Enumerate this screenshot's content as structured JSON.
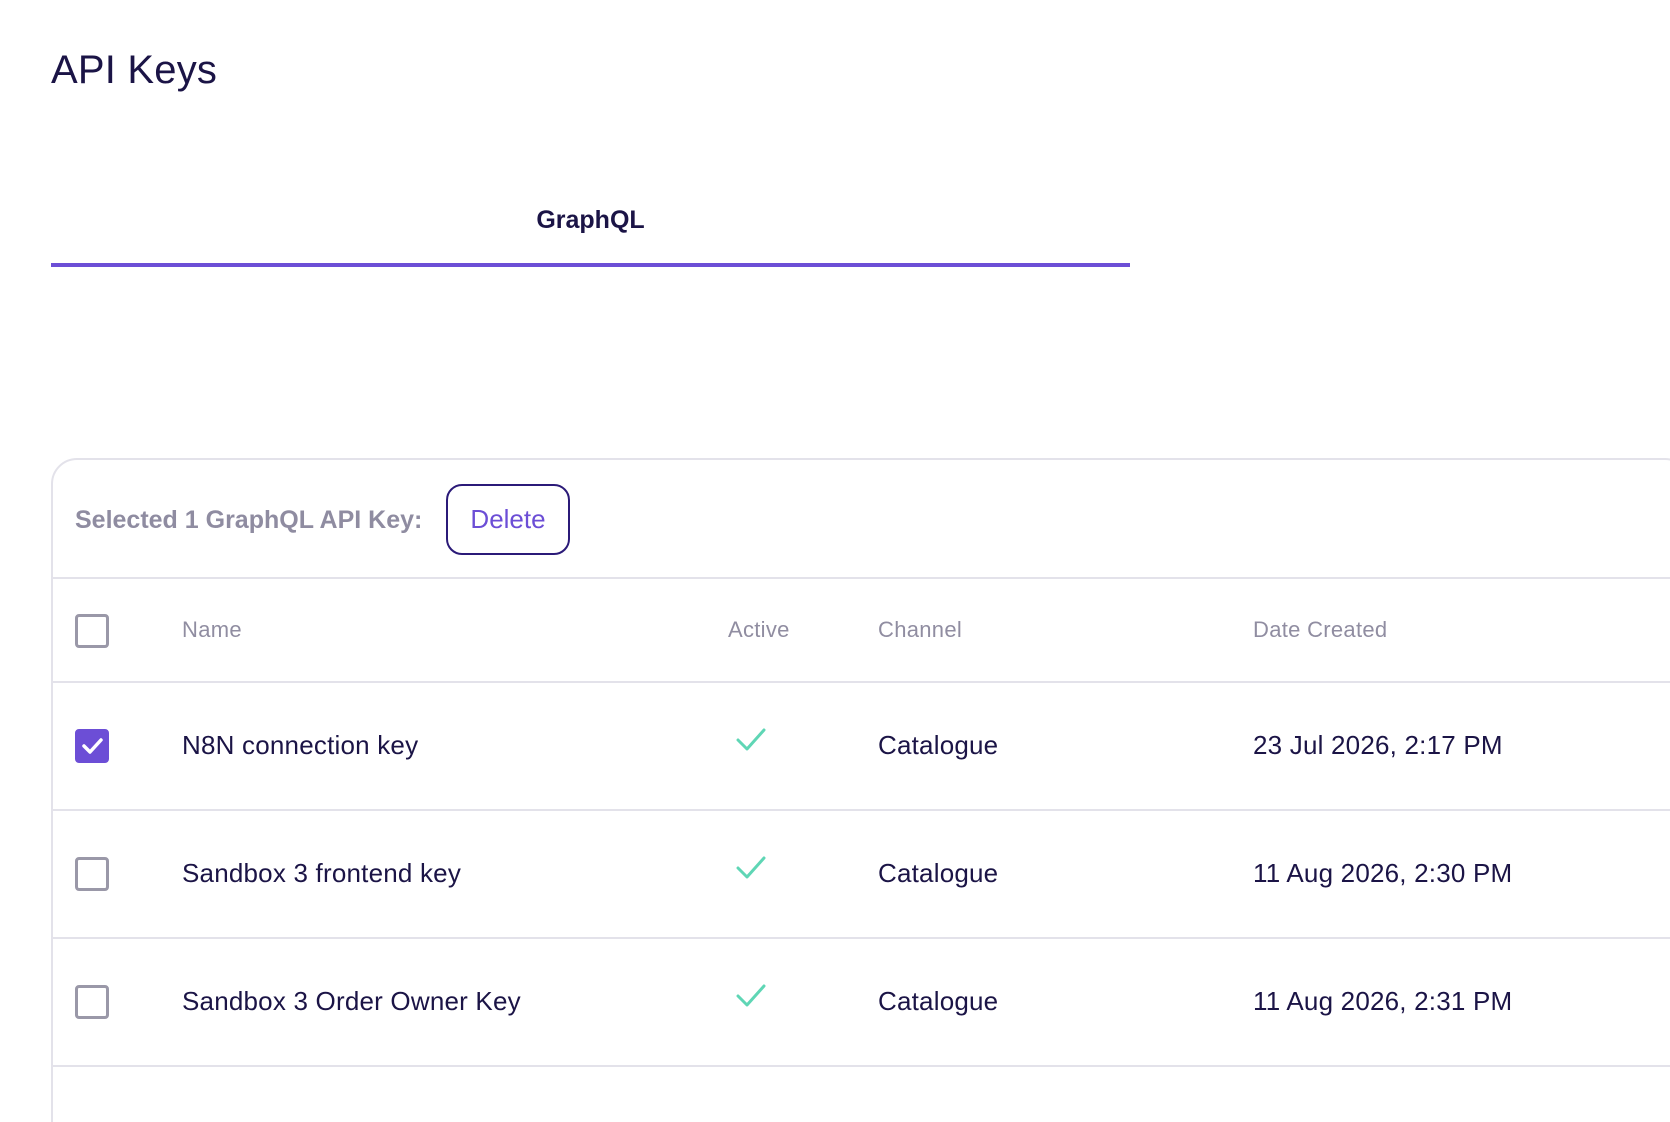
{
  "page": {
    "title": "API Keys"
  },
  "tabs": [
    {
      "label": "GraphQL",
      "active": true
    }
  ],
  "toolbar": {
    "selected_text": "Selected 1 GraphQL API Key:",
    "delete_label": "Delete"
  },
  "table": {
    "headers": [
      "Name",
      "Active",
      "Channel",
      "Date Created"
    ],
    "rows": [
      {
        "selected": true,
        "name": "N8N connection key",
        "active": true,
        "channel": "Catalogue",
        "date_created": "23 Jul 2026, 2:17 PM"
      },
      {
        "selected": false,
        "name": "Sandbox 3 frontend key",
        "active": true,
        "channel": "Catalogue",
        "date_created": "11 Aug 2026, 2:30 PM"
      },
      {
        "selected": false,
        "name": "Sandbox 3 Order Owner Key",
        "active": true,
        "channel": "Catalogue",
        "date_created": "11 Aug 2026, 2:31 PM"
      }
    ]
  },
  "colors": {
    "accent": "#6c4ed6",
    "text": "#1b1446",
    "muted": "#908da1",
    "active_check": "#5fd6b5",
    "border": "#e3e2ea"
  },
  "icons": {
    "active": "checkmark-icon",
    "checked": "checkbox-checked-icon"
  }
}
